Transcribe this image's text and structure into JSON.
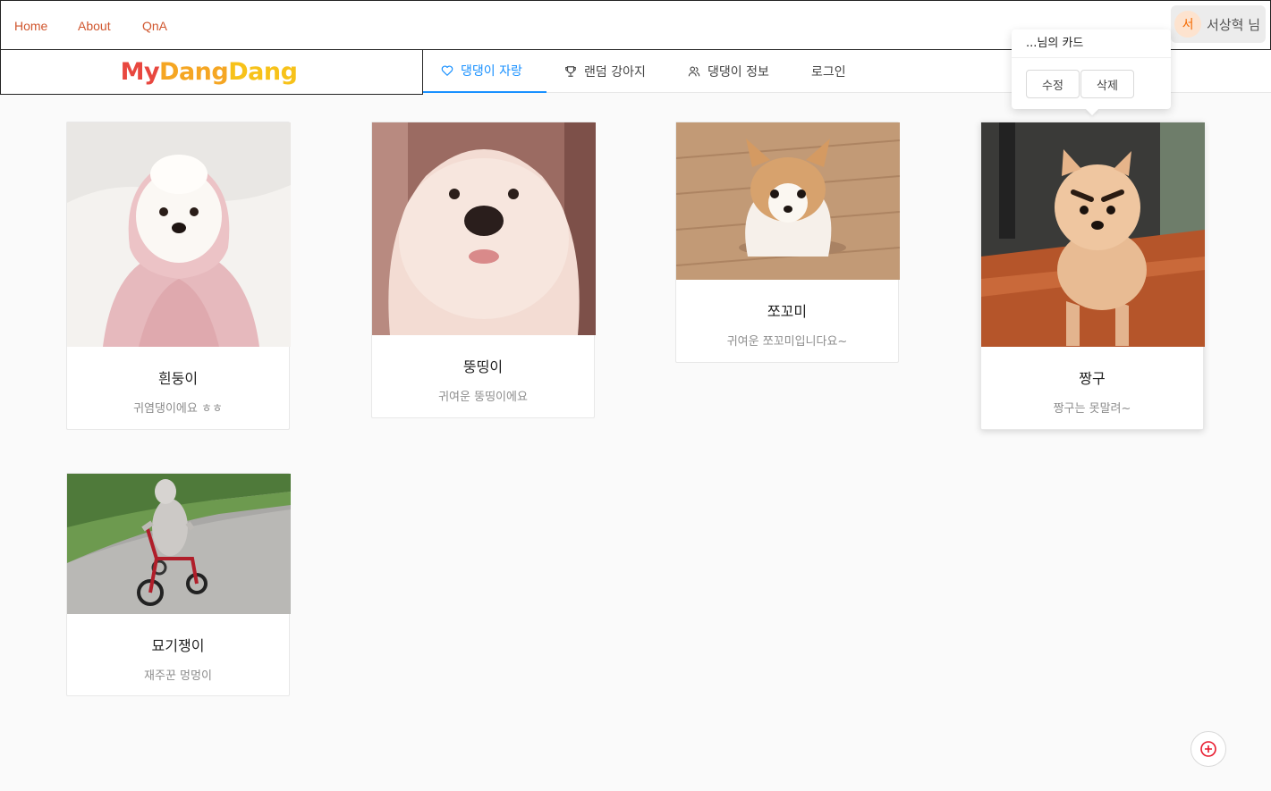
{
  "topnav": {
    "links": [
      "Home",
      "About",
      "QnA"
    ],
    "user": {
      "avatar_initial": "서",
      "name": "서상혁 님"
    }
  },
  "logo": {
    "part1": "My",
    "part2": "Dang",
    "part3": "Dang"
  },
  "menu": {
    "items": [
      {
        "label": "댕댕이 자랑",
        "icon": "heart-icon",
        "active": true
      },
      {
        "label": "랜덤 강아지",
        "icon": "trophy-icon",
        "active": false
      },
      {
        "label": "댕댕이 정보",
        "icon": "people-icon",
        "active": false
      },
      {
        "label": "로그인",
        "icon": "",
        "active": false
      }
    ]
  },
  "popover": {
    "title": "...님의 카드",
    "edit_label": "수정",
    "delete_label": "삭제"
  },
  "cards": [
    {
      "title": "흰둥이",
      "description": "귀염댕이에요 ㅎㅎ"
    },
    {
      "title": "뚱띵이",
      "description": "귀여운 뚱띵이에요"
    },
    {
      "title": "쪼꼬미",
      "description": "귀여운 쪼꼬미입니다요~"
    },
    {
      "title": "짱구",
      "description": "짱구는 못말려~"
    },
    {
      "title": "묘기쟁이",
      "description": "재주꾼 멍멍이"
    }
  ],
  "fab": {
    "icon": "plus-circle-icon"
  },
  "colors": {
    "accent": "#1890ff",
    "toplink": "#d0562e",
    "fab_icon": "#e8192c"
  }
}
